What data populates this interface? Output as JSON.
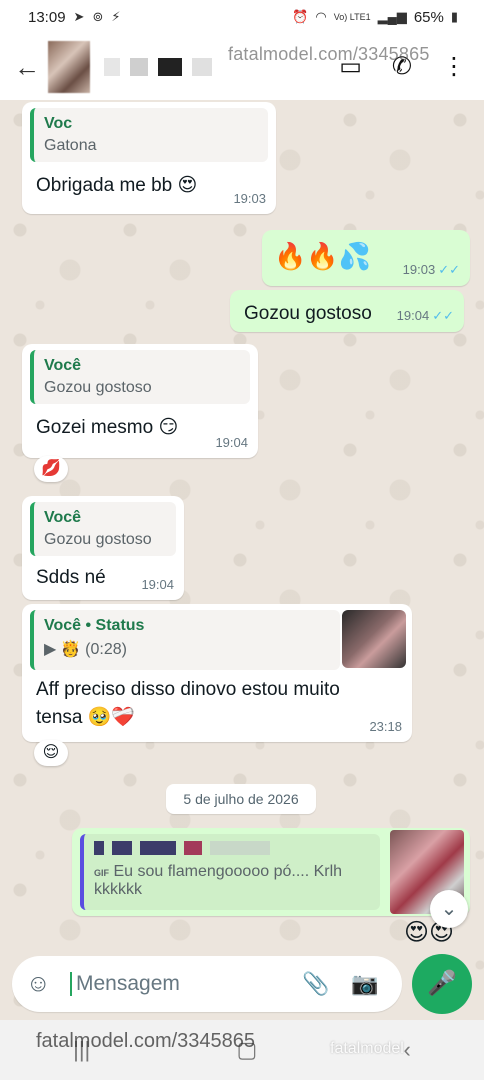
{
  "statusbar": {
    "time": "13:09",
    "battery": "65%",
    "network": "Vo) LTE1"
  },
  "header": {
    "watermark": "fatalmodel.com/3345865"
  },
  "messages": {
    "m1": {
      "quote_author": "Voc",
      "quote_text": "Gatona",
      "text": "Obrigada me bb 😍",
      "time": "19:03"
    },
    "m2": {
      "text": "🔥🔥💦",
      "time": "19:03"
    },
    "m3": {
      "text": "Gozou gostoso",
      "time": "19:04"
    },
    "m4": {
      "quote_author": "Você",
      "quote_text": "Gozou gostoso",
      "text": "Gozei mesmo 😏",
      "time": "19:04",
      "reaction": "💋"
    },
    "m5": {
      "quote_author": "Você",
      "quote_text": "Gozou gostoso",
      "text": "Sdds né",
      "time": "19:04"
    },
    "m6": {
      "quote_author": "Você • Status",
      "quote_text": "(0:28)",
      "text": "Aff preciso disso dinovo estou muito tensa 🥹❤️‍🩹",
      "time": "23:18",
      "reaction": "😌"
    },
    "m7": {
      "quote_text": "Eu sou flamengooooo pó.... Krlh kkkkkk",
      "gif_label": "GIF",
      "reaction": "😍😍"
    }
  },
  "date_chip": "5 de julho de 2026",
  "input": {
    "placeholder": "Mensagem"
  },
  "footer": {
    "watermark": "fatalmodel.com/3345865",
    "brand": "fatalmodel"
  },
  "colors": {
    "accent": "#1daa61",
    "outgoing": "#d9fdd3",
    "incoming": "#ffffff",
    "tick": "#53bdeb"
  }
}
